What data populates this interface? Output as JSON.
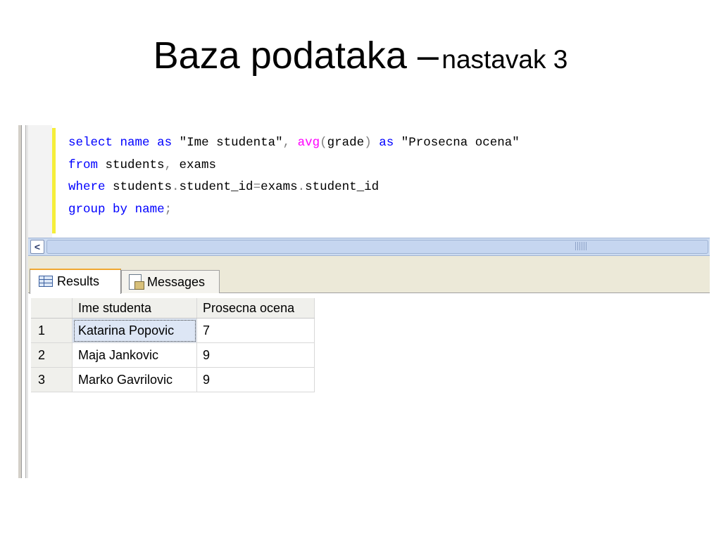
{
  "slide": {
    "title_main": "Baza podataka –",
    "title_sub": "nastavak 3"
  },
  "editor": {
    "lines": [
      [
        {
          "t": "select",
          "c": "kw"
        },
        {
          "t": " "
        },
        {
          "t": "name",
          "c": "kw"
        },
        {
          "t": " "
        },
        {
          "t": "as",
          "c": "kw"
        },
        {
          "t": " \"Ime studenta\""
        },
        {
          "t": ",",
          "c": "gr"
        },
        {
          "t": " "
        },
        {
          "t": "avg",
          "c": "fn"
        },
        {
          "t": "(",
          "c": "gr"
        },
        {
          "t": "grade"
        },
        {
          "t": ")",
          "c": "gr"
        },
        {
          "t": " "
        },
        {
          "t": "as",
          "c": "kw"
        },
        {
          "t": " \"Prosecna ocena\""
        }
      ],
      [
        {
          "t": "from",
          "c": "kw"
        },
        {
          "t": " students"
        },
        {
          "t": ",",
          "c": "gr"
        },
        {
          "t": " exams"
        }
      ],
      [
        {
          "t": "where",
          "c": "kw"
        },
        {
          "t": " students"
        },
        {
          "t": ".",
          "c": "gr"
        },
        {
          "t": "student_id"
        },
        {
          "t": "=",
          "c": "gr"
        },
        {
          "t": "exams"
        },
        {
          "t": ".",
          "c": "gr"
        },
        {
          "t": "student_id"
        }
      ],
      [
        {
          "t": "group",
          "c": "kw"
        },
        {
          "t": " "
        },
        {
          "t": "by",
          "c": "kw"
        },
        {
          "t": " "
        },
        {
          "t": "name",
          "c": "kw"
        },
        {
          "t": ";",
          "c": "gr"
        }
      ]
    ]
  },
  "scrollbar": {
    "left_arrow": "<"
  },
  "tabs": {
    "results": "Results",
    "messages": "Messages"
  },
  "results": {
    "columns": [
      "Ime studenta",
      "Prosecna ocena"
    ],
    "rows": [
      {
        "num": "1",
        "name": "Katarina Popovic",
        "grade": "7"
      },
      {
        "num": "2",
        "name": "Maja Jankovic",
        "grade": "9"
      },
      {
        "num": "3",
        "name": "Marko Gavrilovic",
        "grade": "9"
      }
    ]
  }
}
